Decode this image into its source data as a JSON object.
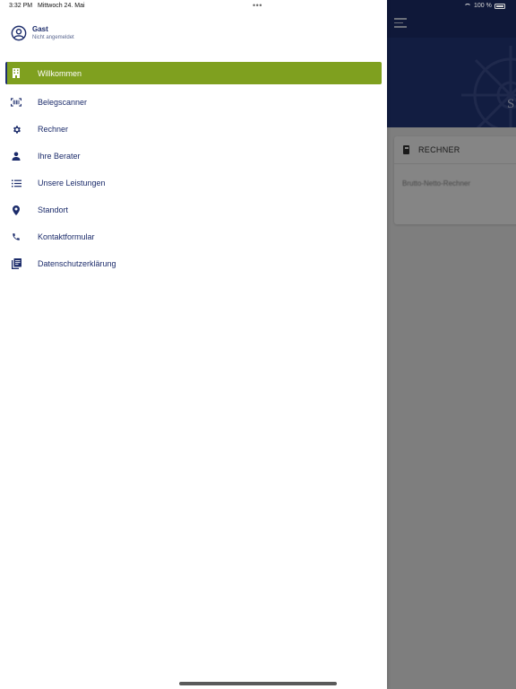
{
  "status_bar": {
    "time": "3:32 PM",
    "date": "Mittwoch 24. Mai",
    "dots": "•••",
    "battery": "100 %"
  },
  "user": {
    "name": "Gast",
    "status": "Nicht angemeldet",
    "icon": "account-circle-icon"
  },
  "nav": {
    "items": [
      {
        "label": "Willkommen",
        "icon": "building-icon",
        "active": true
      },
      {
        "label": "Belegscanner",
        "icon": "barcode-scanner-icon",
        "active": false
      },
      {
        "label": "Rechner",
        "icon": "gear-icon",
        "active": false
      },
      {
        "label": "Ihre Berater",
        "icon": "person-icon",
        "active": false
      },
      {
        "label": "Unsere Leistungen",
        "icon": "list-icon",
        "active": false
      },
      {
        "label": "Standort",
        "icon": "location-pin-icon",
        "active": false
      },
      {
        "label": "Kontaktformular",
        "icon": "phone-icon",
        "active": false
      },
      {
        "label": "Datenschutzerklärung",
        "icon": "document-icon",
        "active": false
      }
    ]
  },
  "background": {
    "hero_text": "S",
    "card_title": "RECHNER",
    "card_link": "Brutto-Netto-Rechner"
  },
  "colors": {
    "primary": "#1e2f6e",
    "accent": "#7fa01f"
  }
}
